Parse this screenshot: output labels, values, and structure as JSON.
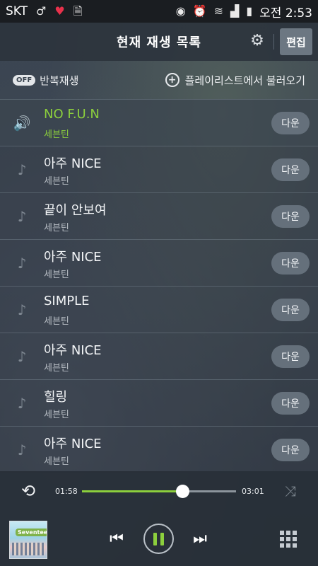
{
  "status_bar": {
    "carrier": "SKT",
    "time": "오전 2:53"
  },
  "header": {
    "title": "현재 재생 목록",
    "edit_label": "편집"
  },
  "options": {
    "off_badge": "OFF",
    "repeat_label": "반복재생",
    "import_label": "플레이리스트에서 불러오기"
  },
  "tracks": [
    {
      "title": "NO F.U.N",
      "artist": "세븐틴",
      "button": "다운",
      "current": true
    },
    {
      "title": "아주 NICE",
      "artist": "세븐틴",
      "button": "다운",
      "current": false
    },
    {
      "title": "끝이 안보여",
      "artist": "세븐틴",
      "button": "다운",
      "current": false
    },
    {
      "title": "아주 NICE",
      "artist": "세븐틴",
      "button": "다운",
      "current": false
    },
    {
      "title": "SIMPLE",
      "artist": "세븐틴",
      "button": "다운",
      "current": false
    },
    {
      "title": "아주 NICE",
      "artist": "세븐틴",
      "button": "다운",
      "current": false
    },
    {
      "title": "힐링",
      "artist": "세븐틴",
      "button": "다운",
      "current": false
    },
    {
      "title": "아주 NICE",
      "artist": "세븐틴",
      "button": "다운",
      "current": false
    }
  ],
  "player": {
    "current_time": "01:58",
    "total_time": "03:01",
    "progress_fraction": 0.65,
    "album_logo_text": "Seventeen"
  },
  "colors": {
    "accent": "#8ccf3d",
    "status_bar_bg": "#1a1d21",
    "download_button_bg": "#65707b"
  },
  "icons": {
    "now_playing": "speaker-icon",
    "track": "music-note-icon",
    "settings": "gear-icon",
    "repeat": "repeat-icon",
    "shuffle": "shuffle-icon",
    "previous": "previous-track-icon",
    "pause": "pause-icon",
    "next": "next-track-icon",
    "playlist_grid": "grid-icon",
    "add": "plus-circle-icon"
  }
}
